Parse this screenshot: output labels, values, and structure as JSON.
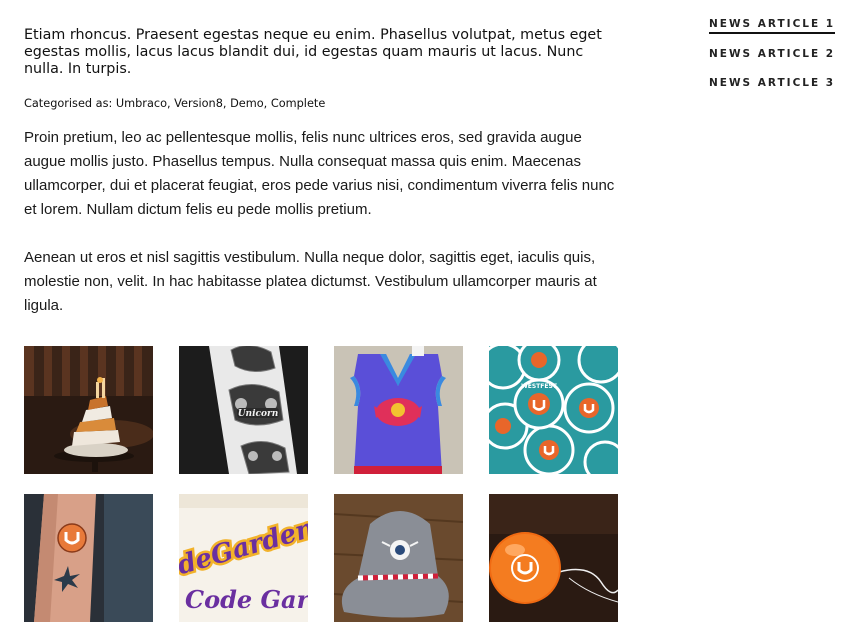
{
  "article": {
    "lede": "Etiam rhoncus. Praesent egestas neque eu enim. Phasellus volutpat, metus eget egestas mollis, lacus lacus blandit dui, id egestas quam mauris ut lacus. Nunc nulla. In turpis.",
    "categories": "Categorised as: Umbraco, Version8, Demo, Complete",
    "paragraphs": [
      "Proin pretium, leo ac pellentesque mollis, felis nunc ultrices eros, sed gravida augue augue mollis justo. Phasellus tempus. Nulla consequat massa quis enim. Maecenas ullamcorper, dui et placerat feugiat, eros pede varius nisi, condimentum viverra felis nunc et lorem. Nullam dictum felis eu pede mollis pretium.",
      "Aenean ut eros et nisl sagittis vestibulum. Nulla neque dolor, sagittis eget, iaculis quis, molestie non, velit. In hac habitasse platea dictumst. Vestibulum ullamcorper mauris at ligula."
    ]
  },
  "gallery": [
    {
      "name": "cake-photo",
      "text": ""
    },
    {
      "name": "unicorn-stickers-photo",
      "text": "Unicorn"
    },
    {
      "name": "knitted-vest-photo",
      "text": ""
    },
    {
      "name": "umbraco-westfest-stickers-photo",
      "text": "WESTFEST"
    },
    {
      "name": "leg-tattoo-photo",
      "text": ""
    },
    {
      "name": "codegarden-sticker-photo",
      "text_top": "deGarden",
      "text_bottom": "Code Gard"
    },
    {
      "name": "felt-hat-photo",
      "text": ""
    },
    {
      "name": "umbraco-yoyo-photo",
      "text": ""
    }
  ],
  "nav": {
    "items": [
      {
        "label": "NEWS ARTICLE 1",
        "active": true
      },
      {
        "label": "NEWS ARTICLE 2",
        "active": false
      },
      {
        "label": "NEWS ARTICLE 3",
        "active": false
      }
    ]
  },
  "colors": {
    "umbraco_orange": "#e8662a",
    "teal": "#2a9aa0",
    "purple": "#6a2fa0",
    "vest_blue": "#5a4fd8"
  }
}
